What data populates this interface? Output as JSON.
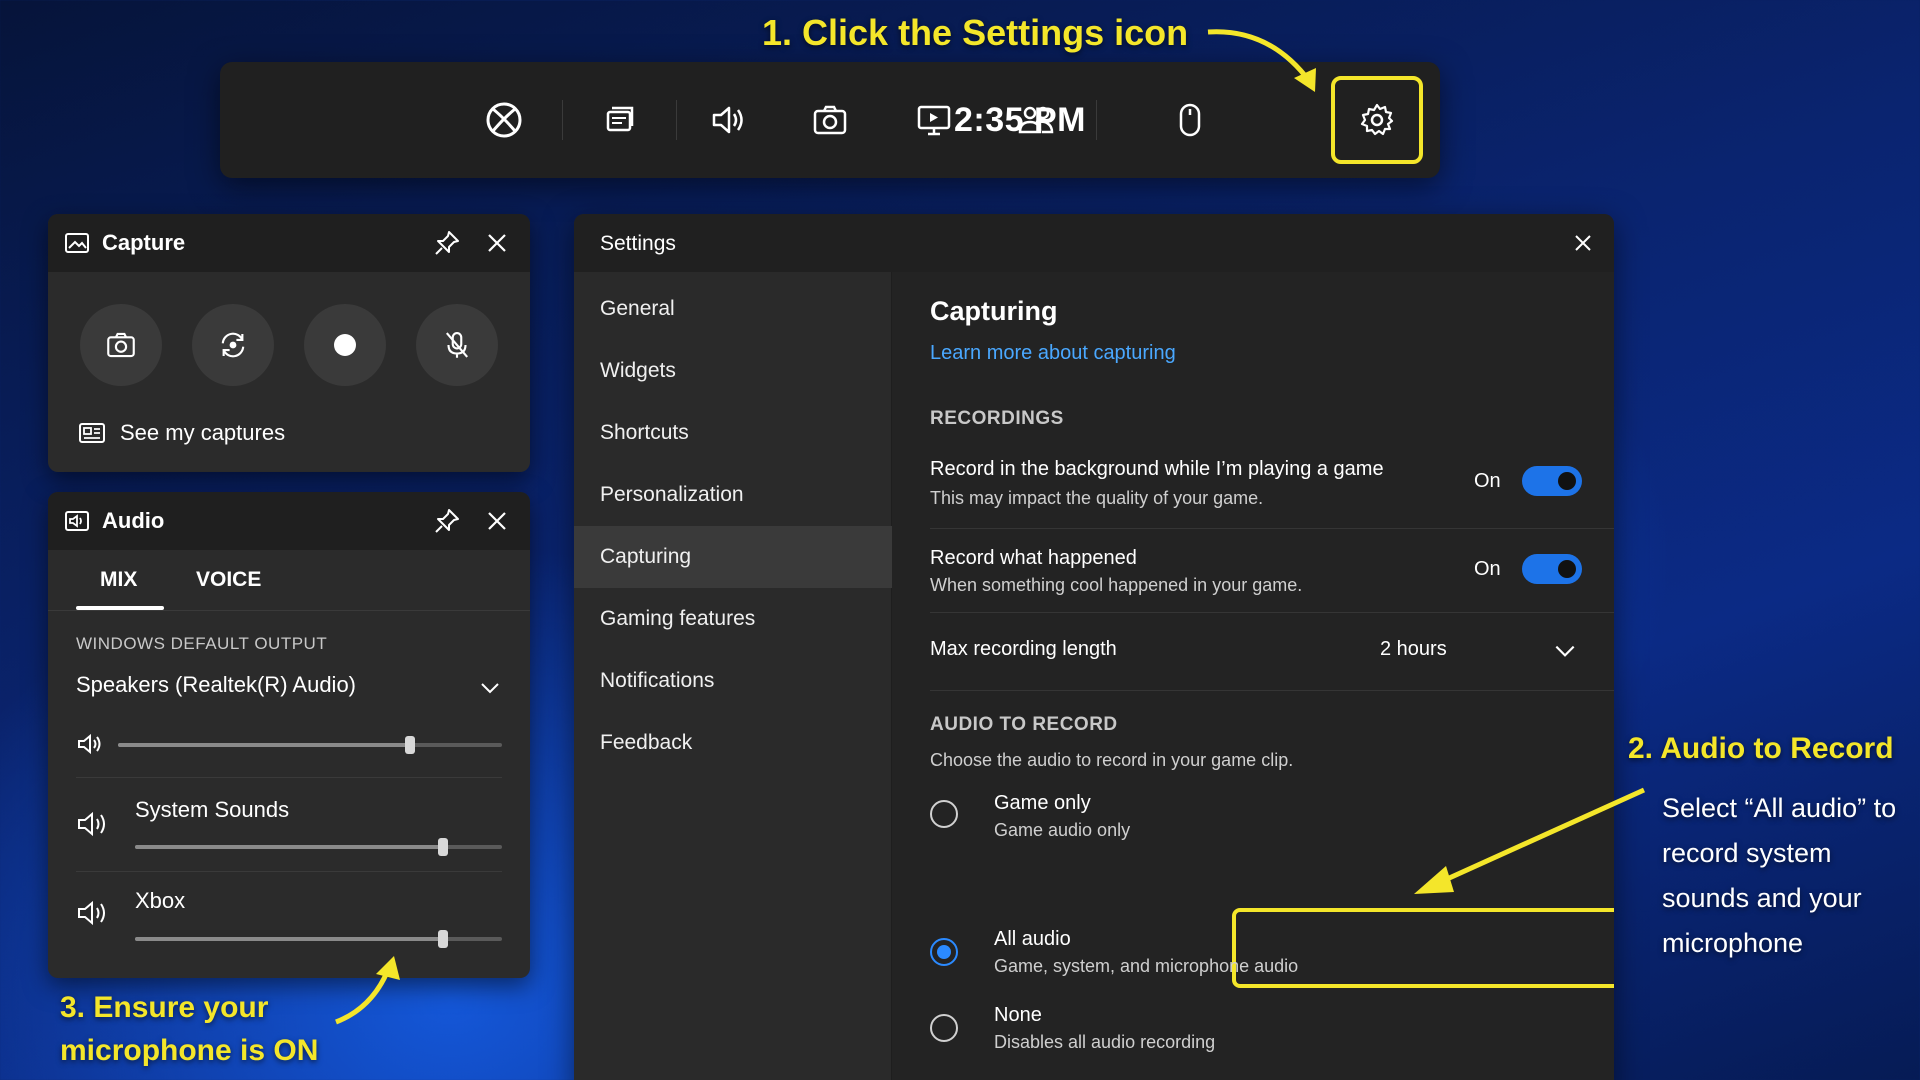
{
  "gamebar": {
    "clock": "2:35 PM",
    "icons": [
      "xbox-icon",
      "widgets-icon",
      "audio-icon",
      "capture-icon",
      "performance-icon",
      "social-icon",
      "mouse-icon",
      "settings-icon"
    ]
  },
  "capture": {
    "title": "Capture",
    "see_captures": "See my captures"
  },
  "audio": {
    "title": "Audio",
    "tabs": [
      "MIX",
      "VOICE"
    ],
    "output_label": "WINDOWS DEFAULT OUTPUT",
    "output_device": "Speakers (Realtek(R) Audio)",
    "master_volume": 0.76,
    "apps": [
      {
        "name": "System Sounds",
        "volume": 0.84
      },
      {
        "name": "Xbox",
        "volume": 0.84
      }
    ]
  },
  "settings": {
    "title": "Settings",
    "nav": [
      "General",
      "Widgets",
      "Shortcuts",
      "Personalization",
      "Capturing",
      "Gaming features",
      "Notifications",
      "Feedback"
    ],
    "active_nav": "Capturing",
    "content": {
      "heading": "Capturing",
      "link": "Learn more about capturing",
      "recordings_label": "RECORDINGS",
      "bg_title": "Record in the background while I’m playing a game",
      "bg_sub": "This may impact the quality of your game.",
      "bg_state": "On",
      "rwh_title": "Record what happened",
      "rwh_sub": "When something cool happened in your game.",
      "rwh_state": "On",
      "max_label": "Max recording length",
      "max_value": "2 hours",
      "audio_label": "AUDIO TO RECORD",
      "audio_desc": "Choose the audio to record in your game clip.",
      "options": [
        {
          "title": "Game only",
          "sub": "Game audio only"
        },
        {
          "title": "All audio",
          "sub": "Game, system, and microphone audio"
        },
        {
          "title": "None",
          "sub": "Disables all audio recording"
        }
      ],
      "selected_option": "All audio"
    }
  },
  "annotations": {
    "step1": "1. Click the Settings icon",
    "step2_title": "2. Audio to Record",
    "step2_desc": "Select “All audio” to record system sounds and your microphone",
    "step3": "3. Ensure your microphone is ON"
  },
  "colors": {
    "accent": "#1d73e8",
    "highlight": "#f4e62a",
    "link": "#4aa8ff"
  }
}
